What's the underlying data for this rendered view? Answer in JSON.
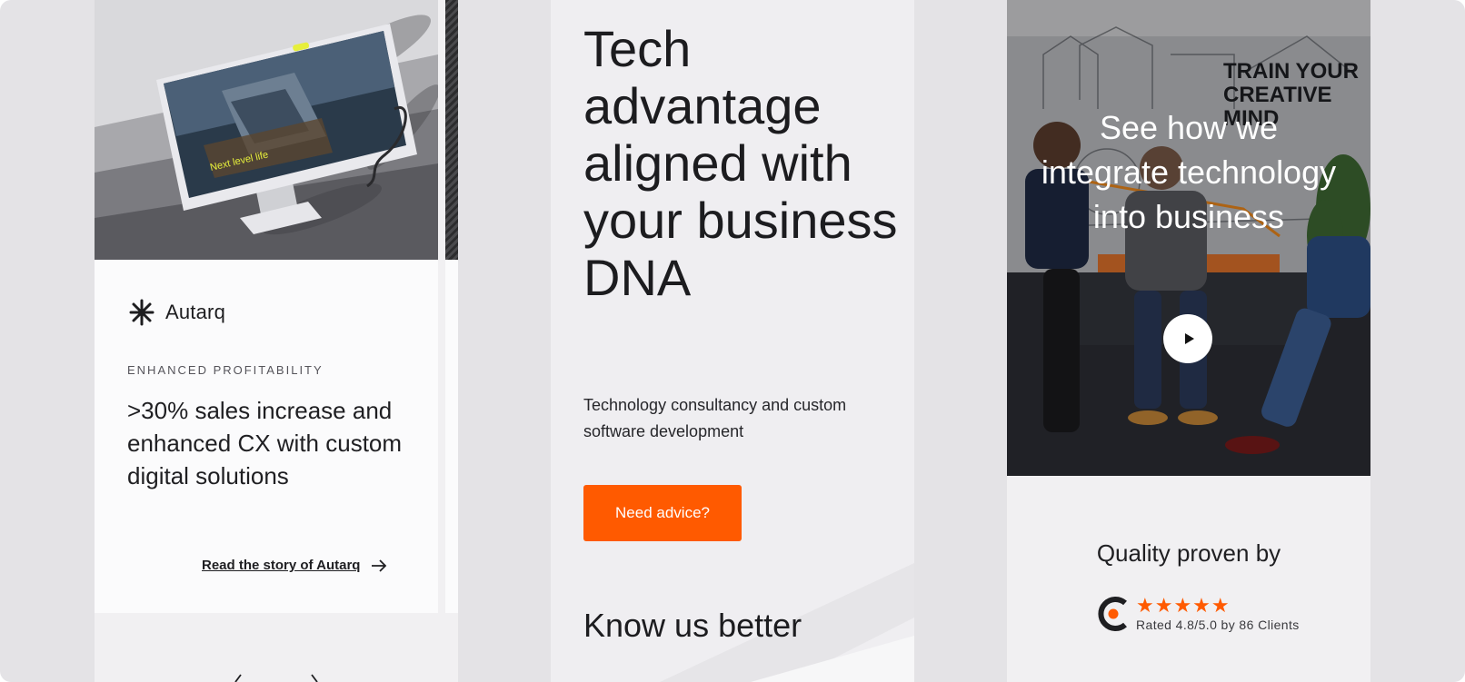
{
  "case_study": {
    "brand": "Autarq",
    "eyebrow": "ENHANCED PROFITABILITY",
    "title": ">30% sales increase and enhanced CX with custom digital solutions",
    "link_label": "Read the story of Autarq",
    "screen_caption": "Next level life"
  },
  "hero": {
    "title": "Tech advantage aligned with your business DNA",
    "subtitle": "Technology consultancy and custom software development",
    "cta_label": "Need advice?",
    "section_title": "Know us better"
  },
  "video": {
    "title": "See how we integrate technology into business",
    "wall_text": "TRAIN YOUR CREATIVE MIND"
  },
  "quality": {
    "title": "Quality proven by",
    "stars": "★★★★★",
    "rating_text": "Rated 4.8/5.0 by 86 Clients"
  },
  "colors": {
    "accent": "#ff5a00",
    "page_bg": "#e4e3e6",
    "text": "#1f1f22"
  }
}
